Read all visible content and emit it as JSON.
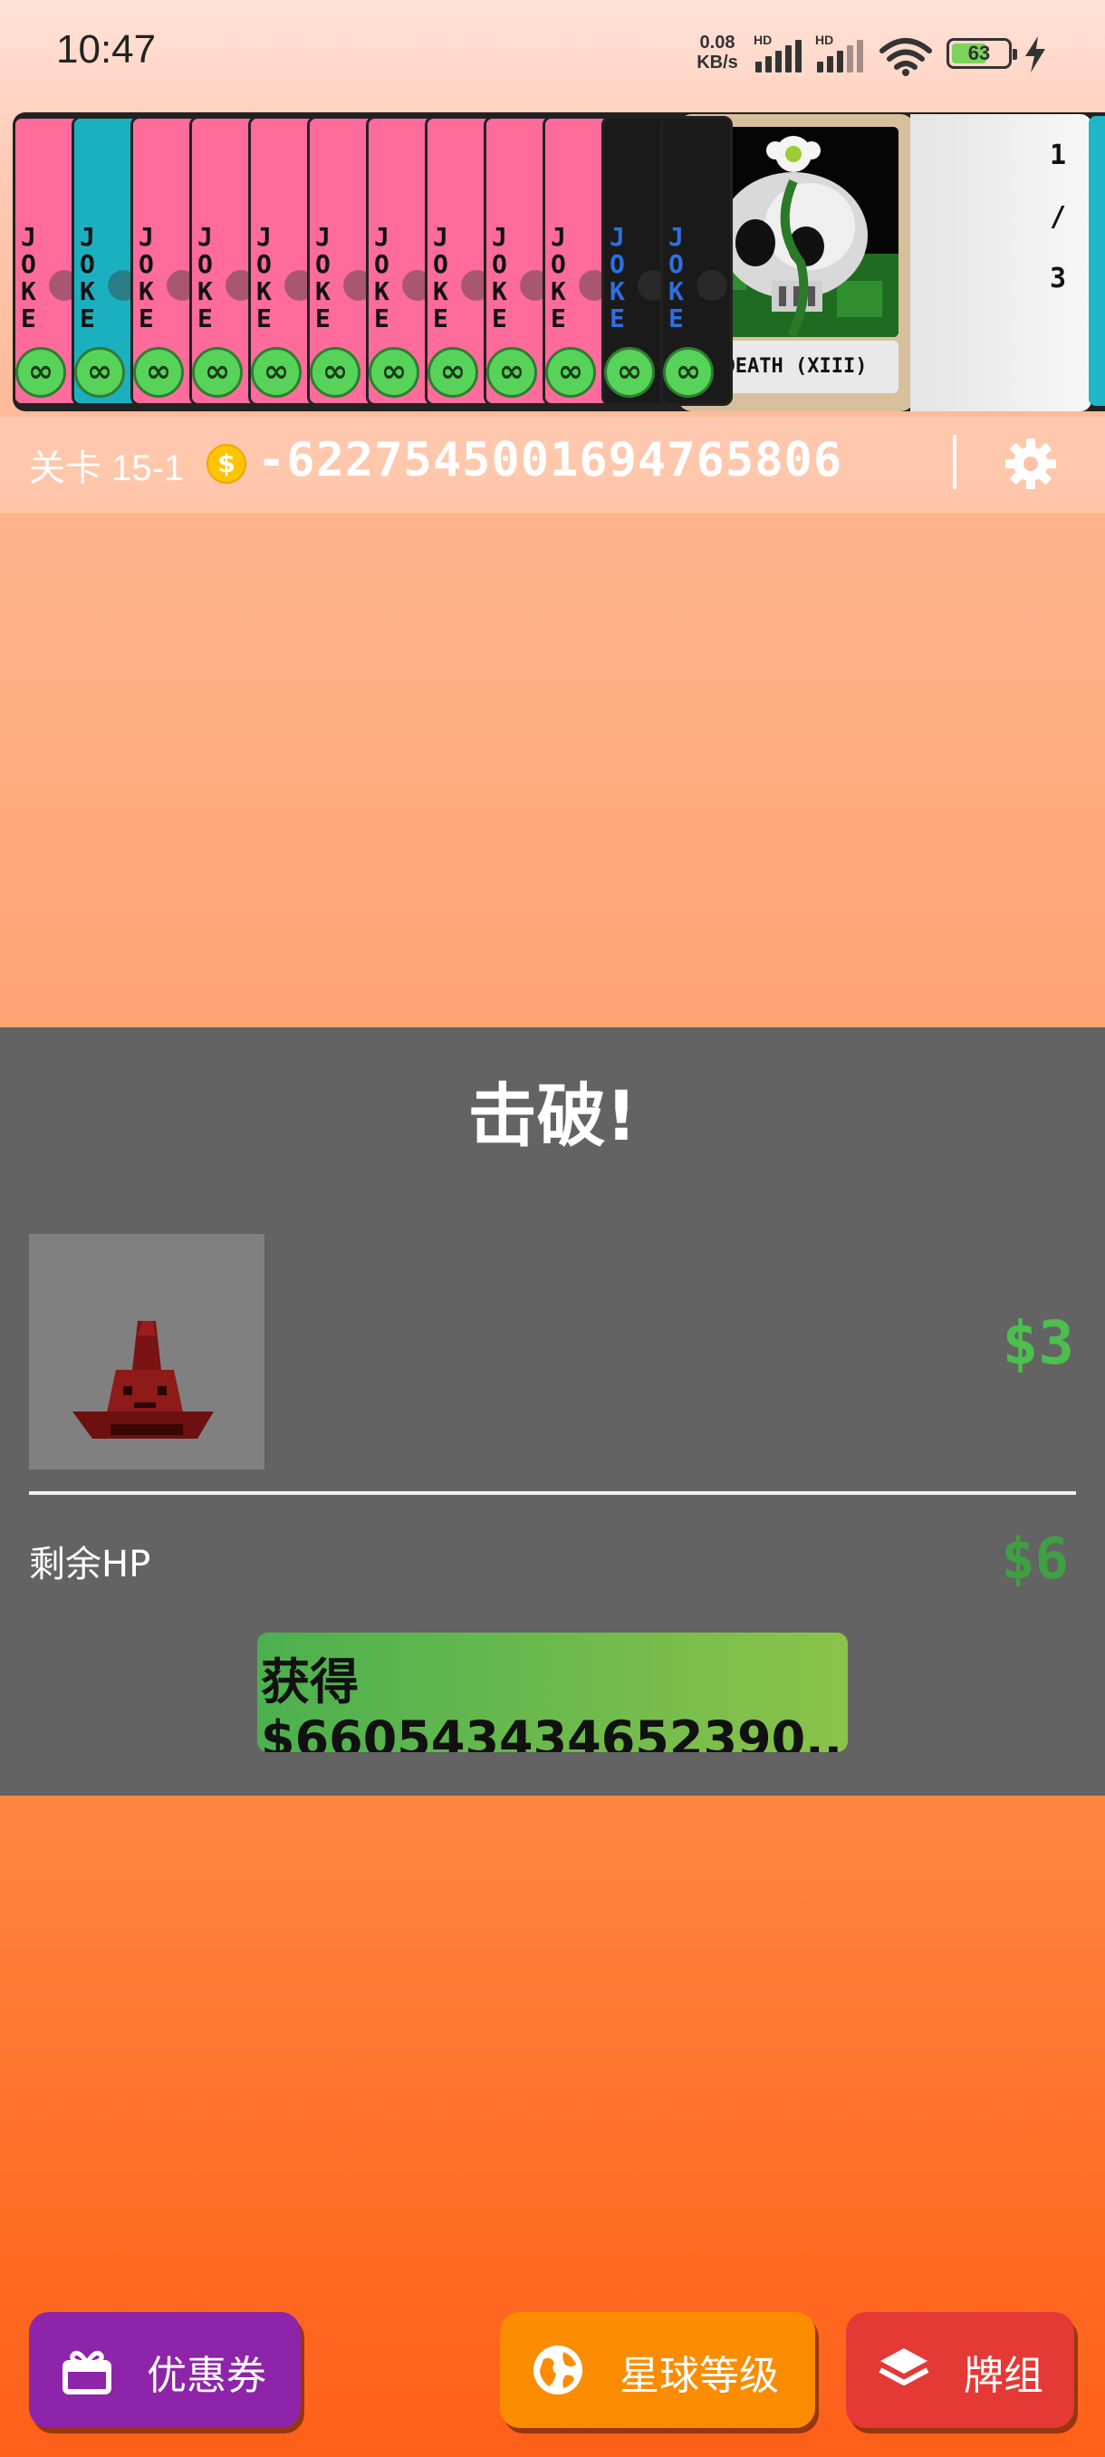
{
  "status_bar": {
    "time": "10:47",
    "net_speed_value": "0.08",
    "net_speed_unit": "KB/s",
    "hd_label": "HD",
    "battery_level": "63",
    "battery_percent": 63
  },
  "hand": {
    "joker_label": "JOKE",
    "copies_symbol": "∞",
    "jokers": [
      {
        "card_color": "#ff6b9a",
        "stripe_color": "#ff6b9a",
        "text_color": "#111111"
      },
      {
        "card_color": "#1bb0c0",
        "stripe_color": "#1bb0c0",
        "text_color": "#111111"
      },
      {
        "card_color": "#ff6b9a",
        "stripe_color": "#ff6b9a",
        "text_color": "#111111"
      },
      {
        "card_color": "#ff6b9a",
        "stripe_color": "#ff6b9a",
        "text_color": "#111111"
      },
      {
        "card_color": "#ff6b9a",
        "stripe_color": "#ff6b9a",
        "text_color": "#111111"
      },
      {
        "card_color": "#ff6b9a",
        "stripe_color": "#ff6b9a",
        "text_color": "#111111"
      },
      {
        "card_color": "#ff6b9a",
        "stripe_color": "#ff6b9a",
        "text_color": "#111111"
      },
      {
        "card_color": "#ff6b9a",
        "stripe_color": "#ff6b9a",
        "text_color": "#111111"
      },
      {
        "card_color": "#ff6b9a",
        "stripe_color": "#ff6b9a",
        "text_color": "#111111"
      },
      {
        "card_color": "#ff6b9a",
        "stripe_color": "#ff6b9a",
        "text_color": "#111111"
      },
      {
        "card_color": "#1a1a1a",
        "stripe_color": "#1a1a1a",
        "text_color": "#2f6fe0"
      },
      {
        "card_color": "#1a1a1a",
        "stripe_color": "#1a1a1a",
        "text_color": "#2f6fe0"
      }
    ],
    "featured_card": {
      "name": "DEATH (XIII)"
    },
    "page": {
      "current": "1",
      "separator": "/",
      "total": "3"
    }
  },
  "info_bar": {
    "level": "关卡 15-1",
    "coin_symbol": "$",
    "money": "-6227545001694765806"
  },
  "defeat_panel": {
    "title": "击破!",
    "enemy_reward": "$3",
    "remaining_hp_label": "剩余HP",
    "hp_reward": "$6",
    "gain_label": "获得",
    "gain_value": "$660543434652390..."
  },
  "bottom_buttons": {
    "coupon": {
      "label": "优惠券",
      "icon": "gift-icon",
      "color": "#8e24aa"
    },
    "planet_level": {
      "label": "星球等级",
      "icon": "globe-icon",
      "color": "#fb8c00"
    },
    "deck": {
      "label": "牌组",
      "icon": "layers-icon",
      "color": "#e53935"
    }
  },
  "colors": {
    "reward_green": "#4cbf4f",
    "panel_gray": "#636363",
    "infinity_badge": "#57d359"
  }
}
